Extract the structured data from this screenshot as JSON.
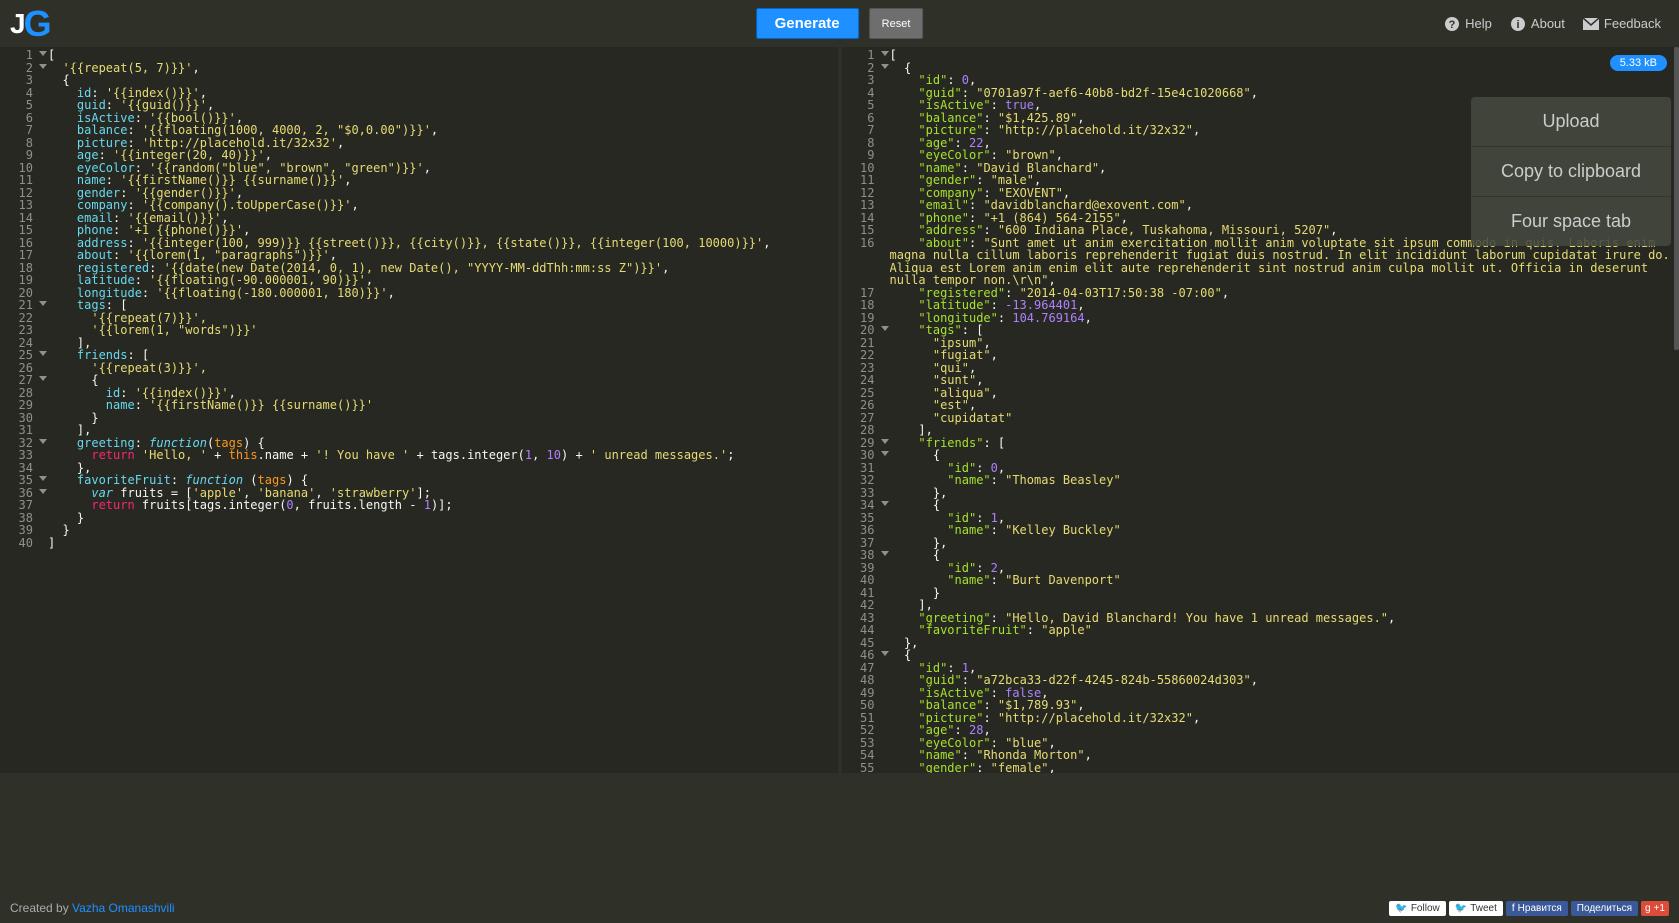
{
  "header": {
    "logo_j": "J",
    "logo_g": "G",
    "generate": "Generate",
    "reset": "Reset",
    "help": "Help",
    "about": "About",
    "feedback": "Feedback"
  },
  "badge": "5.33 kB",
  "sidepanel": {
    "upload": "Upload",
    "copy": "Copy to clipboard",
    "tab": "Four space tab"
  },
  "left_lines": [
    1,
    2,
    3,
    4,
    5,
    6,
    7,
    8,
    9,
    10,
    11,
    12,
    13,
    14,
    15,
    16,
    17,
    18,
    19,
    20,
    21,
    22,
    23,
    24,
    25,
    26,
    27,
    28,
    29,
    30,
    31,
    32,
    33,
    34,
    35,
    36,
    37,
    38,
    39,
    40
  ],
  "left_folds": [
    1,
    2,
    21,
    25,
    27,
    32,
    35,
    36
  ],
  "right_lines": [
    1,
    2,
    3,
    4,
    5,
    6,
    7,
    8,
    9,
    10,
    11,
    12,
    13,
    14,
    15,
    16,
    17,
    18,
    19,
    20,
    21,
    22,
    23,
    24,
    25,
    26,
    27,
    28,
    29,
    30,
    31,
    32,
    33,
    34,
    35,
    36,
    37,
    38,
    39,
    40,
    41,
    42,
    43,
    44,
    45,
    46,
    47,
    48,
    49,
    50,
    51,
    52,
    53,
    54,
    55
  ],
  "right_folds": [
    1,
    2,
    20,
    29,
    30,
    34,
    38,
    46
  ],
  "right_gap_start": 16,
  "right_gap_end": 17,
  "template": {
    "l1": "[",
    "l2_a": "  '{{repeat(5, 7)}}'",
    "l3": "  {",
    "l4_k": "    id",
    "l4_v": "'{{index()}}'",
    "l5_k": "    guid",
    "l5_v": "'{{guid()}}'",
    "l6_k": "    isActive",
    "l6_v": "'{{bool()}}'",
    "l7_k": "    balance",
    "l7_v": "'{{floating(1000, 4000, 2, \"$0,0.00\")}}'",
    "l8_k": "    picture",
    "l8_v": "'http://placehold.it/32x32'",
    "l9_k": "    age",
    "l9_v": "'{{integer(20, 40)}}'",
    "l10_k": "    eyeColor",
    "l10_v": "'{{random(\"blue\", \"brown\", \"green\")}}'",
    "l11_k": "    name",
    "l11_v": "'{{firstName()}} {{surname()}}'",
    "l12_k": "    gender",
    "l12_v": "'{{gender()}}'",
    "l13_k": "    company",
    "l13_v": "'{{company().toUpperCase()}}'",
    "l14_k": "    email",
    "l14_v": "'{{email()}}'",
    "l15_k": "    phone",
    "l15_v": "'+1 {{phone()}}'",
    "l16_k": "    address",
    "l16_v": "'{{integer(100, 999)}} {{street()}}, {{city()}}, {{state()}}, {{integer(100, 10000)}}'",
    "l17_k": "    about",
    "l17_v": "'{{lorem(1, \"paragraphs\")}}'",
    "l18_k": "    registered",
    "l18_v": "'{{date(new Date(2014, 0, 1), new Date(), \"YYYY-MM-ddThh:mm:ss Z\")}}'",
    "l19_k": "    latitude",
    "l19_v": "'{{floating(-90.000001, 90)}}'",
    "l20_k": "    longitude",
    "l20_v": "'{{floating(-180.000001, 180)}}'",
    "l21_k": "    tags",
    "l21_v": "[",
    "l22": "      '{{repeat(7)}}',",
    "l23": "      '{{lorem(1, \"words\")}}'",
    "l24": "    ],",
    "l25_k": "    friends",
    "l25_v": "[",
    "l26": "      '{{repeat(3)}}',",
    "l27": "      {",
    "l28_k": "        id",
    "l28_v": "'{{index()}}'",
    "l29_k": "        name",
    "l29_v": "'{{firstName()}} {{surname()}}'",
    "l30": "      }",
    "l31": "    ],",
    "l32_k": "    greeting",
    "l33_a": "      return ",
    "l33_b": "'Hello, '",
    "l33_c": " + ",
    "l33_d": "this",
    "l33_e": ".name + ",
    "l33_f": "'! You have '",
    "l33_g": " + tags.integer(",
    "l33_h": "1",
    "l33_i": ", ",
    "l33_j": "10",
    "l33_k": ") + ",
    "l33_l": "' unread messages.'",
    "l33_m": ";",
    "l34": "    },",
    "l35_k": "    favoriteFruit",
    "l36_a": "      var",
    "l36_b": " fruits = [",
    "l36_c": "'apple'",
    "l36_d": ", ",
    "l36_e": "'banana'",
    "l36_f": ", ",
    "l36_g": "'strawberry'",
    "l36_h": "];",
    "l37_a": "      return ",
    "l37_b": "fruits[tags.integer(",
    "l37_c": "0",
    "l37_d": ", fruits.length - ",
    "l37_e": "1",
    "l37_f": ")];",
    "l38": "    }",
    "l39": "  }",
    "l40": "]",
    "fn_kw": "function",
    "fn_p": "tags"
  },
  "output": {
    "r1": "[",
    "r2": "  {",
    "r3_k": "\"id\"",
    "r3_v": "0",
    "r4_k": "\"guid\"",
    "r4_v": "\"0701a97f-aef6-40b8-bd2f-15e4c1020668\"",
    "r5_k": "\"isActive\"",
    "r5_v": "true",
    "r6_k": "\"balance\"",
    "r6_v": "\"$1,425.89\"",
    "r7_k": "\"picture\"",
    "r7_v": "\"http://placehold.it/32x32\"",
    "r8_k": "\"age\"",
    "r8_v": "22",
    "r9_k": "\"eyeColor\"",
    "r9_v": "\"brown\"",
    "r10_k": "\"name\"",
    "r10_v": "\"David Blanchard\"",
    "r11_k": "\"gender\"",
    "r11_v": "\"male\"",
    "r12_k": "\"company\"",
    "r12_v": "\"EXOVENT\"",
    "r13_k": "\"email\"",
    "r13_v": "\"davidblanchard@exovent.com\"",
    "r14_k": "\"phone\"",
    "r14_v": "\"+1 (864) 564-2155\"",
    "r15_k": "\"address\"",
    "r15_v": "\"600 Indiana Place, Tuskahoma, Missouri, 5207\"",
    "r16_k": "\"about\"",
    "r16_v": "\"Sunt amet ut anim exercitation mollit anim voluptate sit ipsum commodo in quis. Laboris enim magna nulla cillum laboris reprehenderit fugiat duis nostrud. In elit incididunt laborum cupidatat irure do. Aliqua est Lorem anim enim elit aute reprehenderit sint nostrud anim culpa mollit ut. Officia in deserunt nulla tempor non.\\r\\n\"",
    "r17_k": "\"registered\"",
    "r17_v": "\"2014-04-03T17:50:38 -07:00\"",
    "r18_k": "\"latitude\"",
    "r18_v": "-13.964401",
    "r19_k": "\"longitude\"",
    "r19_v": "104.769164",
    "r20_k": "\"tags\"",
    "r20_v": "[",
    "r21": "\"ipsum\"",
    "r22": "\"fugiat\"",
    "r23": "\"qui\"",
    "r24": "\"sunt\"",
    "r25": "\"aliqua\"",
    "r26": "\"est\"",
    "r27": "\"cupidatat\"",
    "r28": "    ],",
    "r29_k": "\"friends\"",
    "r29_v": "[",
    "r30": "      {",
    "r31_k": "\"id\"",
    "r31_v": "0",
    "r32_k": "\"name\"",
    "r32_v": "\"Thomas Beasley\"",
    "r33": "      },",
    "r34": "      {",
    "r35_k": "\"id\"",
    "r35_v": "1",
    "r36_k": "\"name\"",
    "r36_v": "\"Kelley Buckley\"",
    "r37": "      },",
    "r38": "      {",
    "r39_k": "\"id\"",
    "r39_v": "2",
    "r40_k": "\"name\"",
    "r40_v": "\"Burt Davenport\"",
    "r41": "      }",
    "r42": "    ],",
    "r43_k": "\"greeting\"",
    "r43_v": "\"Hello, David Blanchard! You have 1 unread messages.\"",
    "r44_k": "\"favoriteFruit\"",
    "r44_v": "\"apple\"",
    "r45": "  },",
    "r46": "  {",
    "r47_k": "\"id\"",
    "r47_v": "1",
    "r48_k": "\"guid\"",
    "r48_v": "\"a72bca33-d22f-4245-824b-55860024d303\"",
    "r49_k": "\"isActive\"",
    "r49_v": "false",
    "r50_k": "\"balance\"",
    "r50_v": "\"$1,789.93\"",
    "r51_k": "\"picture\"",
    "r51_v": "\"http://placehold.it/32x32\"",
    "r52_k": "\"age\"",
    "r52_v": "28",
    "r53_k": "\"eyeColor\"",
    "r53_v": "\"blue\"",
    "r54_k": "\"name\"",
    "r54_v": "\"Rhonda Morton\"",
    "r55_k": "\"gender\"",
    "r55_v": "\"female\""
  },
  "footer": {
    "created": "Created by ",
    "author": "Vazha Omanashvili",
    "follow": "Follow",
    "tweet": "Tweet",
    "like": "Нравится",
    "share": "Поделиться",
    "gplus": "+1"
  }
}
